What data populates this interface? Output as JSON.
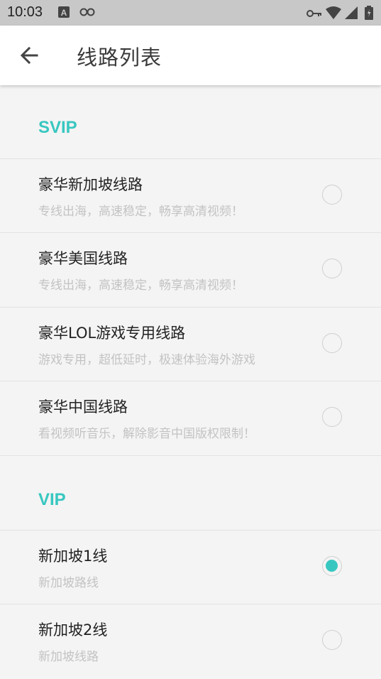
{
  "status_bar": {
    "time": "10:03",
    "icons": [
      "notification-a-icon",
      "link-icon",
      "vpn-key-icon",
      "wifi-icon",
      "signal-icon",
      "battery-icon"
    ]
  },
  "app_bar": {
    "title": "线路列表",
    "back_icon": "back-arrow-icon"
  },
  "colors": {
    "accent": "#38c7c0",
    "background": "#f4f4f4",
    "status_bar": "#c8c8c8"
  },
  "sections": [
    {
      "header": "SVIP",
      "items": [
        {
          "name": "豪华新加坡线路",
          "desc": "专线出海，高速稳定，畅享高清视频！",
          "selected": false
        },
        {
          "name": "豪华美国线路",
          "desc": "专线出海，高速稳定，畅享高清视频！",
          "selected": false
        },
        {
          "name": "豪华LOL游戏专用线路",
          "desc": "游戏专用，超低延时，极速体验海外游戏",
          "selected": false
        },
        {
          "name": "豪华中国线路",
          "desc": "看视频听音乐，解除影音中国版权限制！",
          "selected": false
        }
      ]
    },
    {
      "header": "VIP",
      "items": [
        {
          "name": "新加坡1线",
          "desc": "新加坡路线",
          "selected": true
        },
        {
          "name": "新加坡2线",
          "desc": "新加坡线路",
          "selected": false
        }
      ]
    }
  ]
}
